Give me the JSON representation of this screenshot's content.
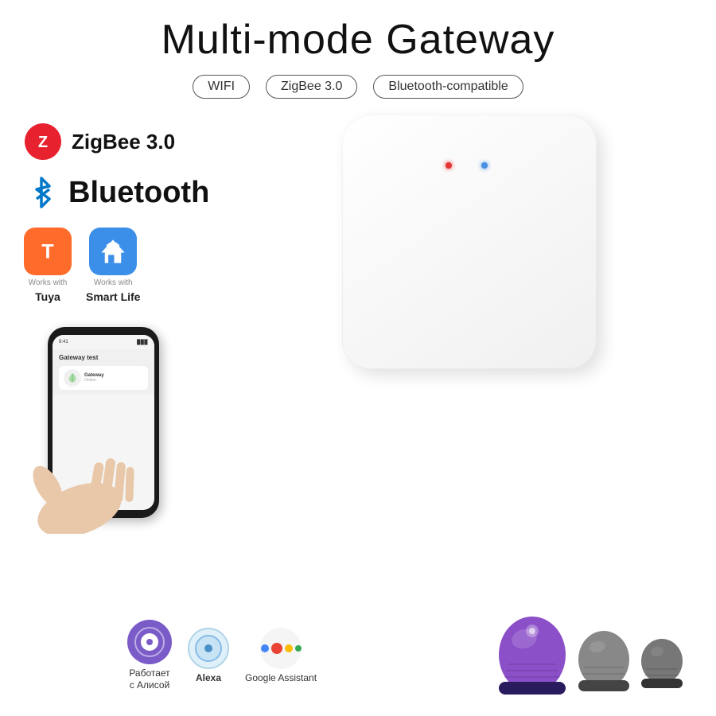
{
  "title": "Multi-mode Gateway",
  "badges": [
    {
      "label": "WIFI"
    },
    {
      "label": "ZigBee 3.0"
    },
    {
      "label": "Bluetooth-compatible"
    }
  ],
  "features": {
    "zigbee": {
      "label": "ZigBee 3.0"
    },
    "bluetooth": {
      "label": "Bluetooth"
    }
  },
  "apps": [
    {
      "id": "tuya",
      "works_with_label": "Works with",
      "name": "Tuya"
    },
    {
      "id": "smartlife",
      "works_with_label": "Works with",
      "name": "Smart Life"
    }
  ],
  "phone_screen": {
    "title": "Gateway test",
    "status": "..."
  },
  "voice_assistants": [
    {
      "id": "alice",
      "label": "Работает\nс Алисой"
    },
    {
      "id": "alexa",
      "label": "Alexa"
    },
    {
      "id": "google",
      "label": "Google Assistant"
    }
  ],
  "colors": {
    "zigbee_red": "#e8212f",
    "bluetooth_blue": "#0078c8",
    "tuya_orange": "#ff6b2b",
    "smartlife_blue": "#3b8fe8",
    "alice_purple": "#7b5bc8",
    "alexa_blue": "#4a90c8",
    "speaker_purple": "#8b4fc8",
    "led_red": "#e63535",
    "led_blue": "#4a90e2"
  }
}
